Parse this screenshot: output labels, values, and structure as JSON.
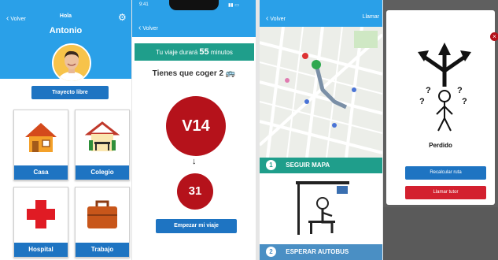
{
  "home": {
    "back_label": "Volver",
    "greeting": "Hola",
    "user_name": "Antonio",
    "free_trip_button": "Trayecto libre",
    "tiles": [
      {
        "label": "Casa",
        "icon": "house-icon"
      },
      {
        "label": "Colegio",
        "icon": "school-icon"
      },
      {
        "label": "Hospital",
        "icon": "hospital-cross-icon"
      },
      {
        "label": "Trabajo",
        "icon": "briefcase-icon"
      }
    ]
  },
  "trip": {
    "status_time": "9:41",
    "back_label": "Volver",
    "duration_prefix": "Tu viaje durará",
    "duration_value": "55",
    "duration_suffix": "minutos",
    "take_text": "Tienes que coger 2",
    "bus_line_1": "V14",
    "bus_line_2": "31",
    "start_button": "Empezar mi viaje"
  },
  "map": {
    "back_label": "Volver",
    "call_label": "Llamar",
    "step1_number": "1",
    "step1_label": "SEGUIR MAPA",
    "step2_number": "2",
    "step2_label": "ESPERAR AUTOBUS"
  },
  "lost": {
    "close_symbol": "×",
    "label": "Perdido",
    "recalc_button": "Recalcular ruta",
    "call_tutor_button": "Llamar tutor"
  },
  "colors": {
    "header_blue": "#2aa0e8",
    "button_blue": "#1e74c2",
    "teal": "#1f9e8b",
    "bus_red": "#b5121b",
    "alert_red": "#d3202f"
  }
}
